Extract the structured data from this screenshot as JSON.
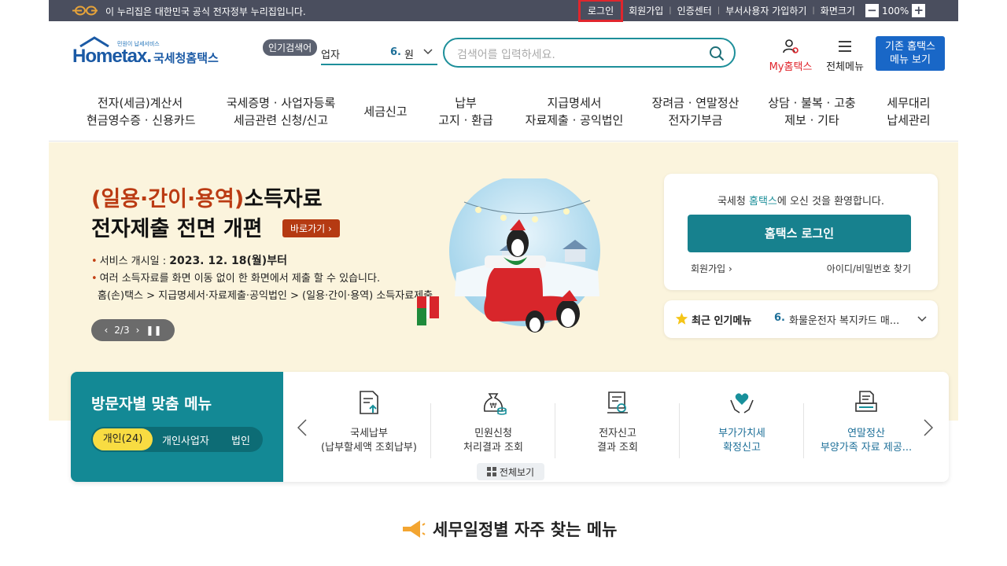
{
  "govbar": {
    "text": "이 누리집은 대한민국 공식 전자정부 누리집입니다.",
    "links": [
      "로그인",
      "회원가입",
      "인증센터",
      "부서사용자 가입하기",
      "화면크기"
    ],
    "zoom": "100%"
  },
  "logo": {
    "tagline": "민원이 납세서비스",
    "word": "Hometax.",
    "name": "국세청홈택스"
  },
  "popular": {
    "badge": "인기검색어",
    "term": "업자",
    "rank": "6.",
    "term2": "원"
  },
  "search": {
    "placeholder": "검색어를 입력하세요."
  },
  "header": {
    "my": "My홈택스",
    "all": "전체메뉴",
    "old_line1": "기존 홈택스",
    "old_line2": "메뉴 보기"
  },
  "nav": [
    {
      "l1": "전자(세금)계산서",
      "l2": "현금영수증 · 신용카드"
    },
    {
      "l1": "국세증명 · 사업자등록",
      "l2": "세금관련 신청/신고"
    },
    {
      "l1": "세금신고",
      "l2": ""
    },
    {
      "l1": "납부",
      "l2": "고지 · 환급"
    },
    {
      "l1": "지급명세서",
      "l2": "자료제출 · 공익법인"
    },
    {
      "l1": "장려금 · 연말정산",
      "l2": "전자기부금"
    },
    {
      "l1": "상담 · 불복 · 고충",
      "l2": "제보 · 기타"
    },
    {
      "l1": "세무대리",
      "l2": "납세관리"
    }
  ],
  "hero": {
    "title_hl": "(일용·간이·용역)",
    "title_rest": "소득자료",
    "title_line2": "전자제출 전면 개편",
    "go": "바로가기",
    "info1_label": "서비스 개시일 : ",
    "info1_date": "2023. 12. 18(월)부터",
    "info2": "여러 소득자료를 화면 이동 없이 한 화면에서 제출 할 수 있습니다.",
    "info3": "홈(손)택스 > 지급명세서·자료제출·공익법인 > (일용·간이·용역) 소득자료제출",
    "pager": "2/3"
  },
  "login": {
    "welcome_pre": "국세청 ",
    "welcome_hl": "홈택스",
    "welcome_post": "에 오신 것을 환영합니다.",
    "button": "홈택스 로그인",
    "join": "회원가입",
    "find": "아이디/비밀번호 찾기"
  },
  "recent": {
    "title": "최근 인기메뉴",
    "rank": "6.",
    "value": "화물운전자 복지카드 매..."
  },
  "visitor": {
    "title": "방문자별 맞춤 메뉴",
    "tabs": [
      "개인(24)",
      "개인사업자",
      "법인"
    ],
    "cards": [
      {
        "l1": "국세납부",
        "l2": "(납부할세액 조회납부)"
      },
      {
        "l1": "민원신청",
        "l2": "처리결과 조회"
      },
      {
        "l1": "전자신고",
        "l2": "결과 조회"
      },
      {
        "l1": "부가가치세",
        "l2": "확정신고"
      },
      {
        "l1": "연말정산",
        "l2": "부양가족 자료 제공..."
      }
    ],
    "all": "전체보기"
  },
  "schedule": {
    "title": "세무일정별 자주 찾는 메뉴"
  }
}
